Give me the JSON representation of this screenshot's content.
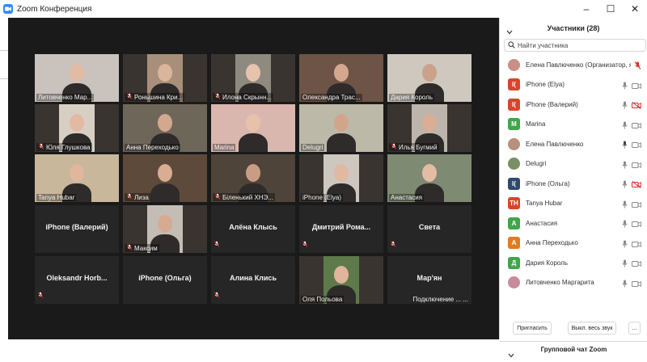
{
  "window": {
    "title": "Zoom Конференция",
    "controls": [
      "–",
      "☐",
      "✕"
    ]
  },
  "video_grid": {
    "tiles": [
      {
        "name": "Литовченко Мар...",
        "type": "video",
        "muted": false,
        "bg": "#c9c2bd",
        "face": "#e2bba5"
      },
      {
        "name": "Роньшина Кри...",
        "type": "video",
        "muted": true,
        "bg": "#a88f7a",
        "face": "#d9b59c"
      },
      {
        "name": "Илона Скрынн...",
        "type": "video",
        "muted": true,
        "bg": "#8f8a80",
        "face": "#e6c3ad"
      },
      {
        "name": "Олександра Трас...",
        "type": "video",
        "muted": false,
        "bg": "#6d5446",
        "face": "#d4a88e"
      },
      {
        "name": "Дария Король",
        "type": "video",
        "muted": false,
        "bg": "#cfc8bf",
        "face": "#caa28b"
      },
      {
        "name": "Юля Глушкова",
        "type": "video",
        "muted": true,
        "bg": "#d8cfc4",
        "face": "#e4b9a2"
      },
      {
        "name": "Анна Переходько",
        "type": "video",
        "muted": false,
        "bg": "#6f665a",
        "face": "#d3a88f"
      },
      {
        "name": "Marina",
        "type": "video",
        "muted": false,
        "bg": "#d9b7ae",
        "face": "#e8c1aa"
      },
      {
        "name": "Delugri",
        "type": "video",
        "muted": false,
        "bg": "#bdb9a9",
        "face": "#d1a58a"
      },
      {
        "name": "Илья Бугмий",
        "type": "video",
        "muted": true,
        "bg": "#bdb5ab",
        "face": "#d9ae94"
      },
      {
        "name": "Tanya Hubar",
        "type": "video",
        "muted": false,
        "bg": "#c8b79b",
        "face": "#e0b69c"
      },
      {
        "name": "Лиза",
        "type": "video",
        "muted": true,
        "bg": "#5d4a3b",
        "face": "#d8ad92"
      },
      {
        "name": "Біленький ХНЭ...",
        "type": "video",
        "muted": true,
        "bg": "#4f4439",
        "face": "#c99d84"
      },
      {
        "name": "iPhone (Elya)",
        "type": "video",
        "muted": false,
        "bg": "#cdc7c0",
        "face": "#e1b8a0"
      },
      {
        "name": "Анастасия",
        "type": "video",
        "muted": false,
        "bg": "#7e8a72",
        "face": "#e3bca4"
      },
      {
        "name": "iPhone (Валерий)",
        "type": "name",
        "muted": false
      },
      {
        "name": "Максим",
        "type": "video",
        "muted": true,
        "bg": "#c4bdb6",
        "face": "#d5aa91"
      },
      {
        "name": "Алёна Клысь",
        "type": "name",
        "muted": true
      },
      {
        "name": "Дмитрий Рома...",
        "type": "name",
        "muted": true
      },
      {
        "name": "Света",
        "type": "name",
        "muted": true
      },
      {
        "name": "Oleksandr Horb...",
        "type": "name",
        "muted": true
      },
      {
        "name": "iPhone (Ольга)",
        "type": "name",
        "muted": false
      },
      {
        "name": "Алина Клись",
        "type": "name",
        "muted": true
      },
      {
        "name": "Оля Польова",
        "type": "video",
        "muted": false,
        "bg": "#5f7a4a",
        "face": "#e0b59b"
      },
      {
        "name": "Мар'ян",
        "type": "name",
        "muted": false,
        "sub": "Подключение ... ..."
      }
    ]
  },
  "participants_panel": {
    "title": "Участники (28)",
    "search_placeholder": "Найти участника",
    "invite_label": "Пригласить",
    "mute_all_label": "Выкл. весь звук",
    "more_label": "...",
    "chat_title": "Групповой чат Zoom",
    "participants": [
      {
        "name": "Елена Павлюченко (Организатор, я)",
        "avatar": "photo",
        "color": "#c98f86",
        "mic": "muted-red",
        "cam": "none",
        "org": true
      },
      {
        "name": "iPhone (Elya)",
        "avatar": "I(",
        "color": "#d9452b",
        "mic": "on",
        "cam": "on"
      },
      {
        "name": "iPhone (Валерий)",
        "avatar": "I(",
        "color": "#d9452b",
        "mic": "on",
        "cam": "off"
      },
      {
        "name": "Marina",
        "avatar": "M",
        "color": "#3fa64a",
        "mic": "on",
        "cam": "on"
      },
      {
        "name": "Елена Павлюченко",
        "avatar": "photo",
        "color": "#b98f7e",
        "mic": "active",
        "cam": "on"
      },
      {
        "name": "Delugri",
        "avatar": "photo",
        "color": "#7a8f66",
        "mic": "on",
        "cam": "on"
      },
      {
        "name": "iPhone (Ольга)",
        "avatar": "I(",
        "color": "#2f4a6e",
        "mic": "on",
        "cam": "off"
      },
      {
        "name": "Tanya Hubar",
        "avatar": "TH",
        "color": "#d9452b",
        "mic": "on",
        "cam": "on"
      },
      {
        "name": "Анастасия",
        "avatar": "A",
        "color": "#3fa64a",
        "mic": "on",
        "cam": "on"
      },
      {
        "name": "Анна Переходько",
        "avatar": "A",
        "color": "#e07b1f",
        "mic": "on",
        "cam": "on"
      },
      {
        "name": "Дария Король",
        "avatar": "Д",
        "color": "#3fa64a",
        "mic": "on",
        "cam": "on"
      },
      {
        "name": "Литовченко Маргарита",
        "avatar": "photo",
        "color": "#c98a9b",
        "mic": "on",
        "cam": "on"
      }
    ]
  },
  "colors": {
    "muted": "#e02828",
    "grid_bg": "#1a1a1a",
    "tile_bg": "#262626",
    "zoom_blue": "#2d8cff"
  }
}
